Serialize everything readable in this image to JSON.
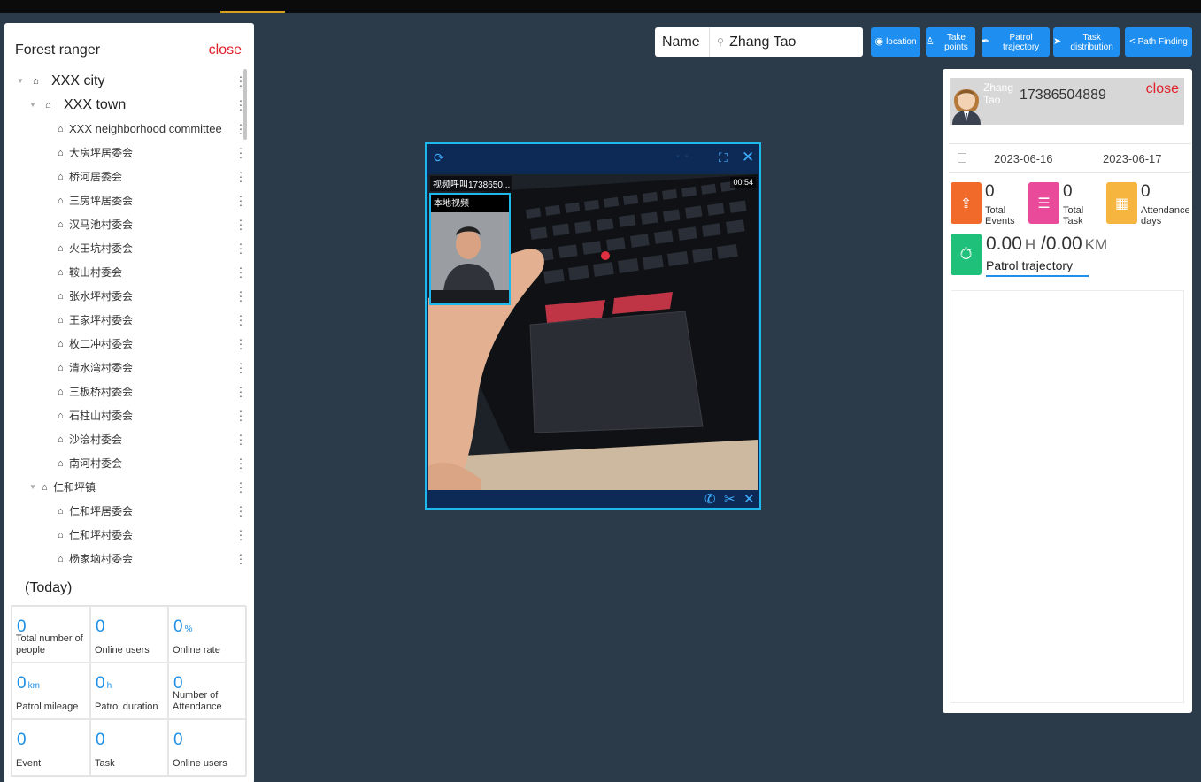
{
  "left_panel": {
    "title": "Forest ranger",
    "close_label": "close",
    "tree": [
      {
        "label": "XXX city",
        "level": 0,
        "expanded": true
      },
      {
        "label": "XXX town",
        "level": 1,
        "expanded": true
      },
      {
        "label": "XXX neighborhood committee",
        "level": 2
      },
      {
        "label": "大房坪居委会",
        "level": 2
      },
      {
        "label": "桥河居委会",
        "level": 2
      },
      {
        "label": "三房坪居委会",
        "level": 2
      },
      {
        "label": "汉马池村委会",
        "level": 2
      },
      {
        "label": "火田坑村委会",
        "level": 2
      },
      {
        "label": "鞍山村委会",
        "level": 2
      },
      {
        "label": "张水坪村委会",
        "level": 2
      },
      {
        "label": "王家坪村委会",
        "level": 2
      },
      {
        "label": "枚二冲村委会",
        "level": 2
      },
      {
        "label": "清水湾村委会",
        "level": 2
      },
      {
        "label": "三板桥村委会",
        "level": 2
      },
      {
        "label": "石柱山村委会",
        "level": 2
      },
      {
        "label": "沙浍村委会",
        "level": 2
      },
      {
        "label": "南河村委会",
        "level": 2
      },
      {
        "label": "仁和坪镇",
        "level": 1,
        "expanded": true
      },
      {
        "label": "仁和坪居委会",
        "level": 2
      },
      {
        "label": "仁和坪村委会",
        "level": 2
      },
      {
        "label": "杨家垴村委会",
        "level": 2
      }
    ],
    "today_label": "(Today)",
    "stats": [
      {
        "value": "0",
        "unit": "",
        "label": "Total number of people"
      },
      {
        "value": "0",
        "unit": "",
        "label": "Online users"
      },
      {
        "value": "0",
        "unit": "%",
        "label": "Online rate"
      },
      {
        "value": "0",
        "unit": "km",
        "label": "Patrol mileage"
      },
      {
        "value": "0",
        "unit": "h",
        "label": "Patrol duration"
      },
      {
        "value": "0",
        "unit": "",
        "label": "Number of Attendance"
      },
      {
        "value": "0",
        "unit": "",
        "label": "Event"
      },
      {
        "value": "0",
        "unit": "",
        "label": "Task"
      },
      {
        "value": "0",
        "unit": "",
        "label": "Online users"
      }
    ]
  },
  "toolbar": {
    "name_label": "Name",
    "search_value": "Zhang Tao",
    "buttons": [
      "location",
      "Take points",
      "Patrol trajectory",
      "Task distribution",
      "Path Finding"
    ]
  },
  "video": {
    "caller_id": "视频呼叫1738650...",
    "timer": "00:54",
    "local_label": "本地视频"
  },
  "right_panel": {
    "name": "Zhang Tao",
    "phone": "17386504889",
    "close_label": "close",
    "date_from": "2023-06-16",
    "date_to": "2023-06-17",
    "metrics": [
      {
        "value": "0",
        "label": "Total Events"
      },
      {
        "value": "0",
        "label": "Total Task"
      },
      {
        "value": "0",
        "label": "Attendance days"
      }
    ],
    "patrol_hours": "0.00",
    "hours_unit": "H",
    "patrol_km": "/0.00",
    "km_unit": "KM",
    "patrol_title": "Patrol trajectory"
  },
  "colors": {
    "background": "#2c3b4a",
    "accent_blue": "#1e8ff0",
    "close_red": "#e0202a",
    "stat_blue": "#1e90e8",
    "events_orange": "#f26a2a",
    "task_pink": "#e94b9a",
    "attendance_yellow": "#f6b53e",
    "patrol_green": "#1ec07a",
    "video_border": "#1fb8ec"
  }
}
